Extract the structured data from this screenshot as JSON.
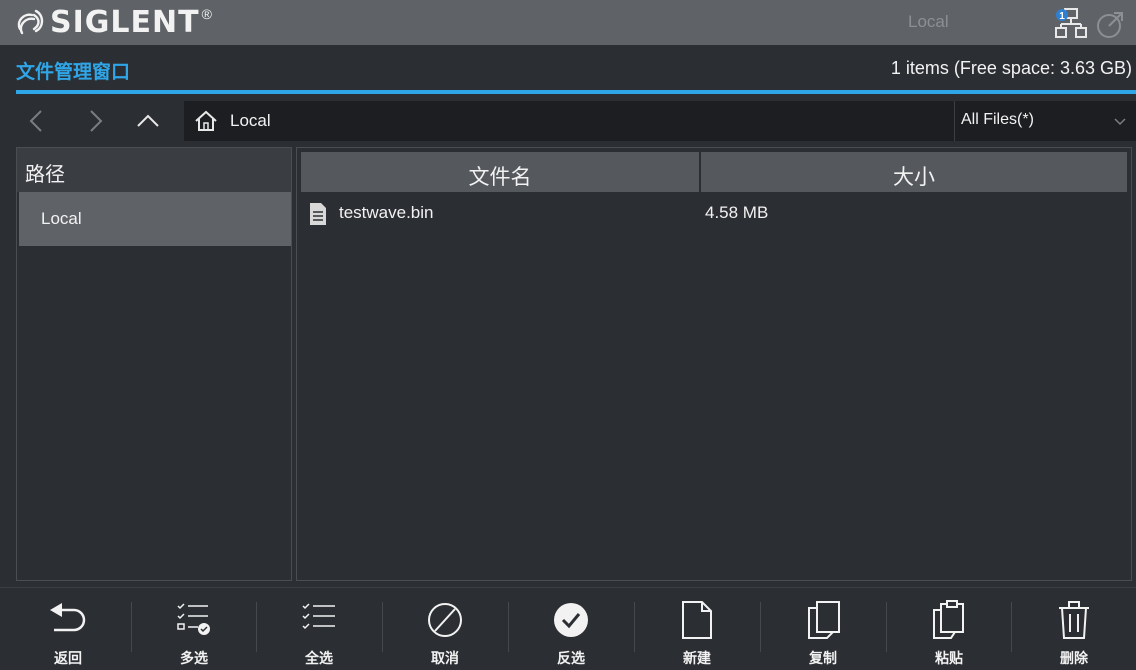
{
  "brand": {
    "name": "SIGLENT",
    "registered": "®"
  },
  "top_status": {
    "location": "Local",
    "network_badge": "1"
  },
  "window": {
    "title": "文件管理窗口",
    "items_info": "1 items (Free space: 3.63 GB)"
  },
  "nav": {
    "path": "Local",
    "filter": "All Files(*)"
  },
  "left_panel": {
    "header": "路径",
    "items": [
      {
        "label": "Local"
      }
    ]
  },
  "file_table": {
    "columns": [
      "文件名",
      "大小"
    ],
    "rows": [
      {
        "name": "testwave.bin",
        "size": "4.58 MB"
      }
    ]
  },
  "toolbar": {
    "back": "返回",
    "multi_select": "多选",
    "select_all": "全选",
    "cancel": "取消",
    "invert": "反选",
    "new": "新建",
    "copy": "复制",
    "paste": "粘贴",
    "delete": "删除"
  },
  "colors": {
    "accent": "#2fa6e8",
    "topbar": "#5f6368",
    "background": "#2b2e32"
  }
}
